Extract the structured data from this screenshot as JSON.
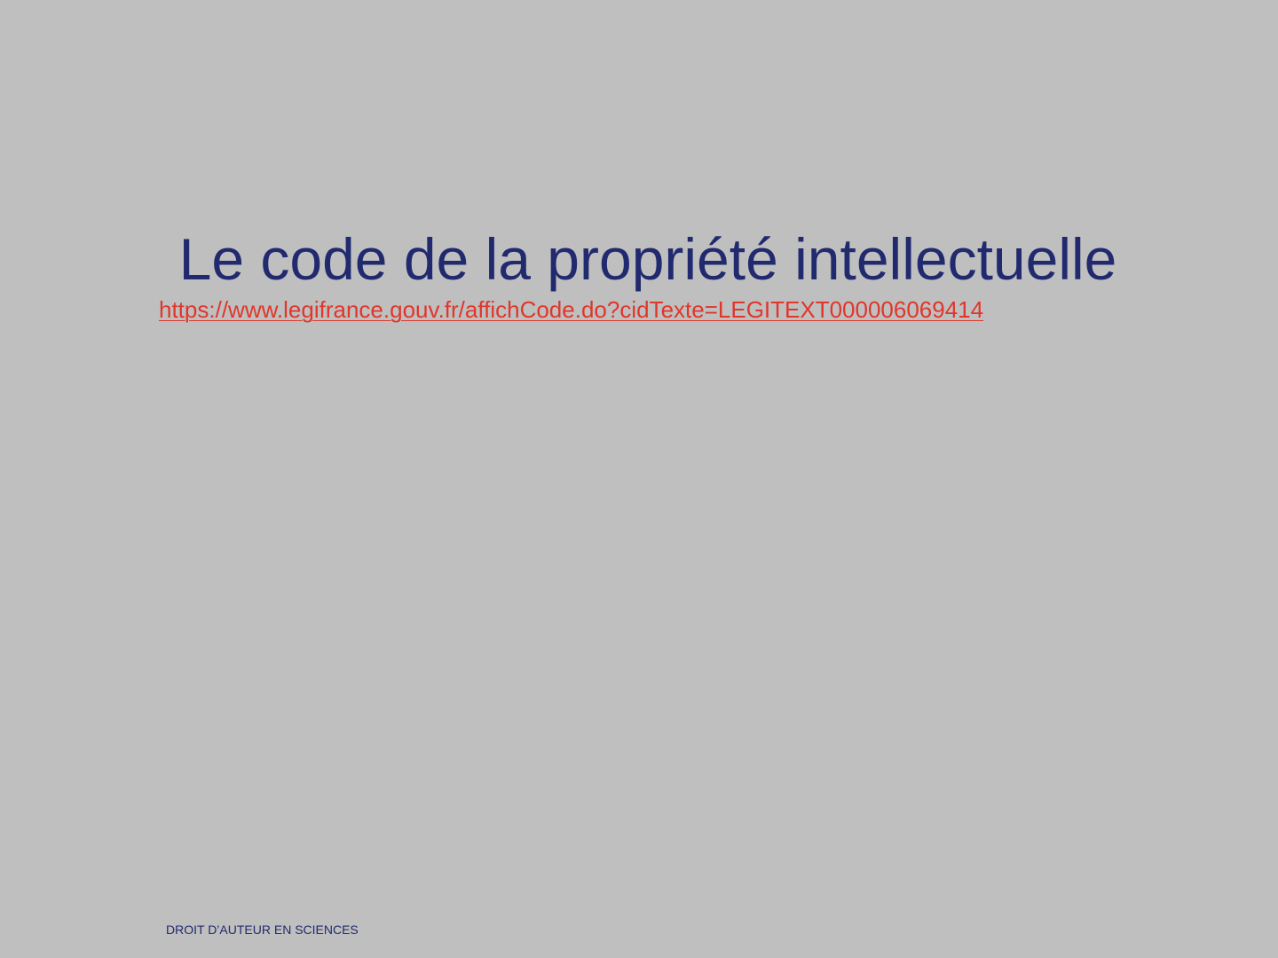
{
  "slide": {
    "title": "Le code de la propriété intellectuelle",
    "link": "https://www.legifrance.gouv.fr/affichCode.do?cidTexte=LEGITEXT000006069414",
    "footer": "DROIT D’AUTEUR EN SCIENCES"
  },
  "colors": {
    "background": "#bfbfbf",
    "title": "#212a6e",
    "link": "#e0362b",
    "footer": "#212a6e"
  }
}
